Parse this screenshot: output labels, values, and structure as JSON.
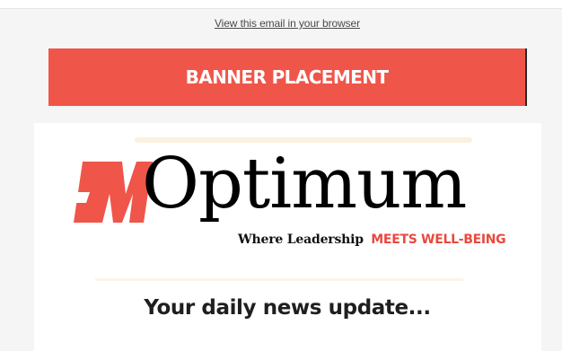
{
  "email": {
    "view_in_browser": "View this email in your browser",
    "banner": "BANNER PLACEMENT",
    "headline": "Your daily news update..."
  },
  "logo": {
    "mark": "BM",
    "name": "Optimum",
    "tagline_part1": "Where Leadership",
    "tagline_part2": "MEETS WELL-BEING"
  },
  "colors": {
    "banner": "#f0554a",
    "accent": "#e84a3f",
    "background": "#f5f5f5",
    "card": "#ffffff"
  }
}
